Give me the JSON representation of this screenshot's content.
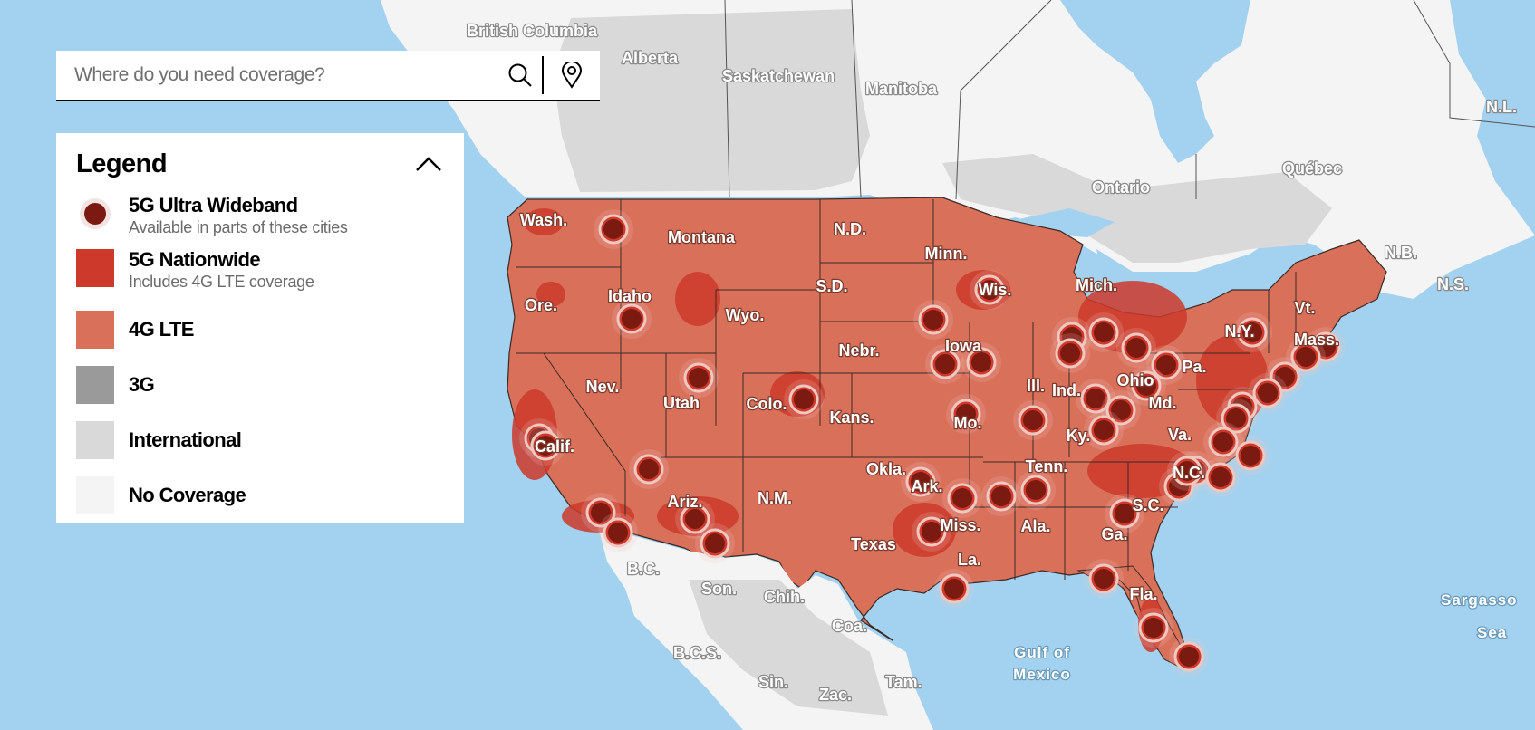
{
  "search": {
    "placeholder": "Where do you need coverage?",
    "search_icon": "search-icon",
    "location_icon": "location-pin-icon"
  },
  "legend": {
    "title": "Legend",
    "collapse_icon": "chevron-up-icon",
    "items": [
      {
        "key": "uwb",
        "label": "5G Ultra Wideband",
        "sublabel": "Available in parts of these cities",
        "color": "#7a1a10",
        "shape": "dot"
      },
      {
        "key": "nationwide",
        "label": "5G Nationwide",
        "sublabel": "Includes 4G LTE coverage",
        "color": "#cd3a2b",
        "shape": "square"
      },
      {
        "key": "lte",
        "label": "4G LTE",
        "sublabel": "",
        "color": "#d9705a",
        "shape": "square"
      },
      {
        "key": "3g",
        "label": "3G",
        "sublabel": "",
        "color": "#9a9a9a",
        "shape": "square"
      },
      {
        "key": "intl",
        "label": "International",
        "sublabel": "",
        "color": "#d9d9d9",
        "shape": "square"
      },
      {
        "key": "none",
        "label": "No Coverage",
        "sublabel": "",
        "color": "#f4f4f4",
        "shape": "square"
      }
    ]
  },
  "map": {
    "colors": {
      "water": "#a2d2ef",
      "lte": "#d9705a",
      "nationwide": "#cd3a2b",
      "uwb_core": "#7a1a10",
      "uwb_ring": "#f0c8c2",
      "international": "#d9d9d9",
      "no_coverage": "#f4f4f4",
      "border": "#3a2a26"
    },
    "us_state_labels": [
      "Wash.",
      "Montana",
      "N.D.",
      "Minn.",
      "Ore.",
      "Idaho",
      "S.D.",
      "Wis.",
      "Mich.",
      "Wyo.",
      "Nebr.",
      "Iowa",
      "N.Y.",
      "Vt.",
      "Mass.",
      "Pa.",
      "Nev.",
      "Utah",
      "Colo.",
      "Ill.",
      "Ind.",
      "Ohio",
      "Kans.",
      "Mo.",
      "Ky.",
      "Md.",
      "Va.",
      "Calif.",
      "Okla.",
      "Ark.",
      "Tenn.",
      "N.C.",
      "S.C.",
      "Ariz.",
      "N.M.",
      "Miss.",
      "Ala.",
      "Ga.",
      "Texas",
      "La.",
      "Fla."
    ],
    "intl_labels": [
      "British Columbia",
      "Alberta",
      "Saskatchewan",
      "Manitoba",
      "Ontario",
      "Québec",
      "N.L.",
      "N.B.",
      "N.S.",
      "B.C.",
      "Son.",
      "Chih.",
      "Coa.",
      "B.C.S.",
      "Sin.",
      "Zac.",
      "Tam."
    ],
    "water_labels": [
      "Gulf of Mexico",
      "Sargasso Sea"
    ],
    "uwb_cities": [
      "Spokane",
      "Boise",
      "Salt Lake City",
      "Denver",
      "Minneapolis",
      "Sioux Falls",
      "Omaha",
      "Des Moines",
      "Kansas City",
      "St. Louis",
      "Chicago",
      "Milwaukee",
      "Grand Rapids",
      "Detroit",
      "Cleveland",
      "Indianapolis",
      "Columbus",
      "Cincinnati",
      "Louisville",
      "Buffalo",
      "Boston",
      "Providence",
      "Hartford",
      "New York",
      "Philadelphia",
      "Baltimore",
      "Washington",
      "Richmond",
      "Norfolk",
      "Raleigh",
      "Charlotte",
      "Greensboro",
      "Atlanta",
      "Nashville",
      "Memphis",
      "Little Rock",
      "Oklahoma City",
      "Dallas",
      "Houston",
      "Tallahassee",
      "Tampa",
      "Miami",
      "Phoenix",
      "Tucson",
      "Las Vegas",
      "San Francisco",
      "San Jose",
      "Los Angeles",
      "San Diego"
    ]
  }
}
